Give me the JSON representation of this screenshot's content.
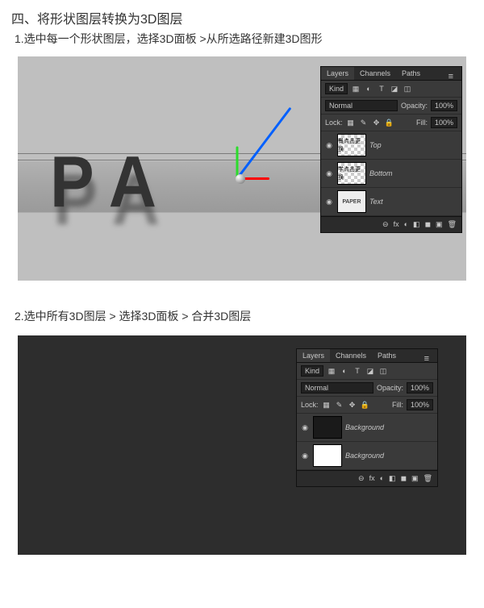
{
  "heading": "四、将形状图层转换为3D图层",
  "step1": "1.选中每一个形状图层，选择3D面板 >从所选路径新建3D图形",
  "step2": "2.选中所有3D图层 > 选择3D面板 > 合并3D图层",
  "letters": [
    "P",
    "A"
  ],
  "panel": {
    "tabs": [
      "Layers",
      "Channels",
      "Paths"
    ],
    "kind_label": "Kind",
    "kind_filter": "ρ",
    "blend": "Normal",
    "opacity_label": "Opacity:",
    "opacity_val": "100%",
    "lock_label": "Lock:",
    "fill_label": "Fill:",
    "fill_val": "100%",
    "thumbs1": [
      {
        "label": "餐点击更换",
        "name": "Top"
      },
      {
        "label": "学点击更换",
        "name": "Bottom"
      },
      {
        "label": "PAPER",
        "name": "Text"
      }
    ],
    "thumbs2": [
      {
        "name": "Background"
      },
      {
        "name": "Background"
      }
    ],
    "foot_icons": [
      "⊖",
      "fx",
      "◐",
      "◧",
      "◼",
      "▣",
      "⊕",
      "🗑"
    ]
  }
}
